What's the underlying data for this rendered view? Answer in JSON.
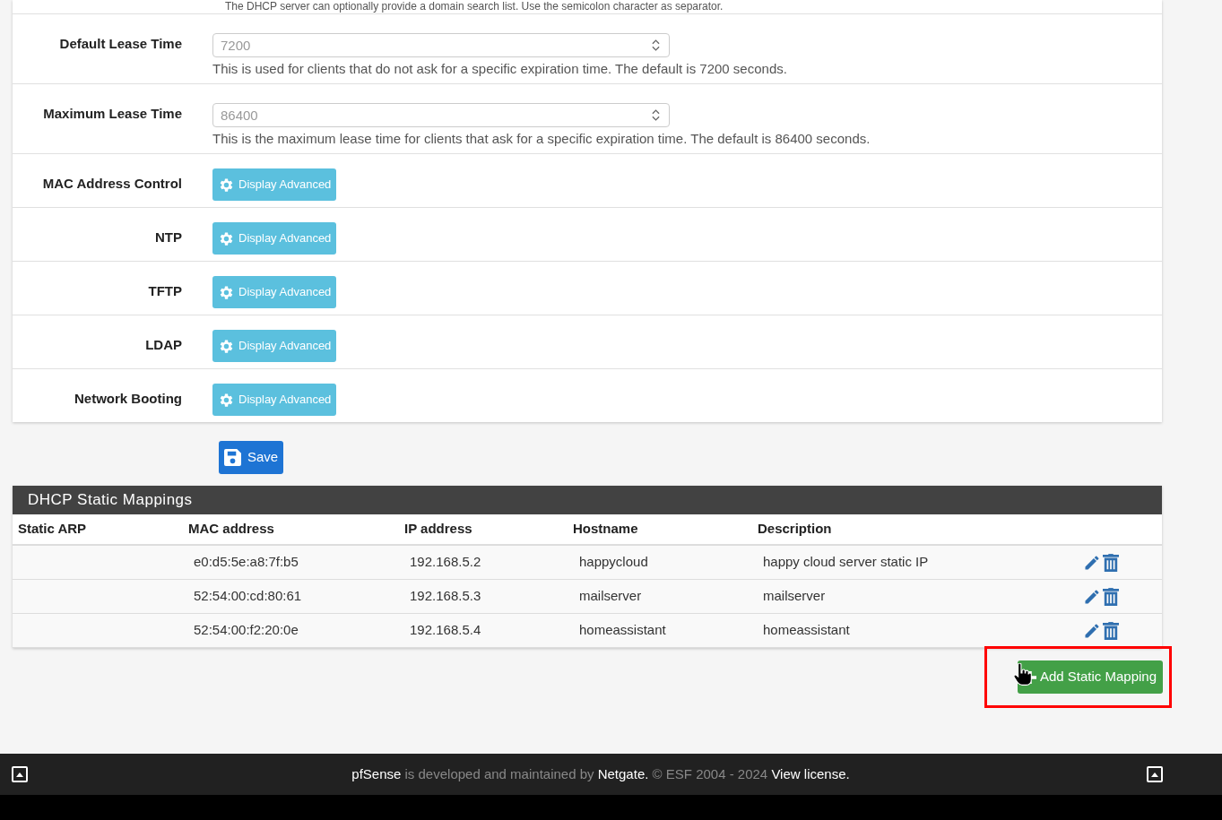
{
  "top_help": "The DHCP server can optionally provide a domain search list. Use the semicolon character as separator.",
  "settings": [
    {
      "kind": "number",
      "label": "Default Lease Time",
      "placeholder": "7200",
      "help": "This is used for clients that do not ask for a specific expiration time. The default is 7200 seconds."
    },
    {
      "kind": "number",
      "label": "Maximum Lease Time",
      "placeholder": "86400",
      "help": "This is the maximum lease time for clients that ask for a specific expiration time. The default is 86400 seconds."
    },
    {
      "kind": "advanced",
      "label": "MAC Address Control",
      "button": "Display Advanced"
    },
    {
      "kind": "advanced",
      "label": "NTP",
      "button": "Display Advanced"
    },
    {
      "kind": "advanced",
      "label": "TFTP",
      "button": "Display Advanced"
    },
    {
      "kind": "advanced",
      "label": "LDAP",
      "button": "Display Advanced"
    },
    {
      "kind": "advanced",
      "label": "Network Booting",
      "button": "Display Advanced"
    }
  ],
  "save_button": "Save",
  "mappings": {
    "title": "DHCP Static Mappings",
    "columns": [
      "Static ARP",
      "MAC address",
      "IP address",
      "Hostname",
      "Description"
    ],
    "rows": [
      {
        "mac": "e0:d5:5e:a8:7f:b5",
        "ip": "192.168.5.2",
        "hostname": "happycloud",
        "description": "happy cloud server static IP"
      },
      {
        "mac": "52:54:00:cd:80:61",
        "ip": "192.168.5.3",
        "hostname": "mailserver",
        "description": "mailserver"
      },
      {
        "mac": "52:54:00:f2:20:0e",
        "ip": "192.168.5.4",
        "hostname": "homeassistant",
        "description": "homeassistant"
      }
    ],
    "add_button": "Add Static Mapping"
  },
  "footer": [
    {
      "kind": "link",
      "text": "pfSense"
    },
    {
      "kind": "text",
      "text": "is developed and maintained by"
    },
    {
      "kind": "link",
      "text": "Netgate."
    },
    {
      "kind": "text",
      "text": "© ESF 2004 - 2024"
    },
    {
      "kind": "link",
      "text": "View license."
    }
  ]
}
